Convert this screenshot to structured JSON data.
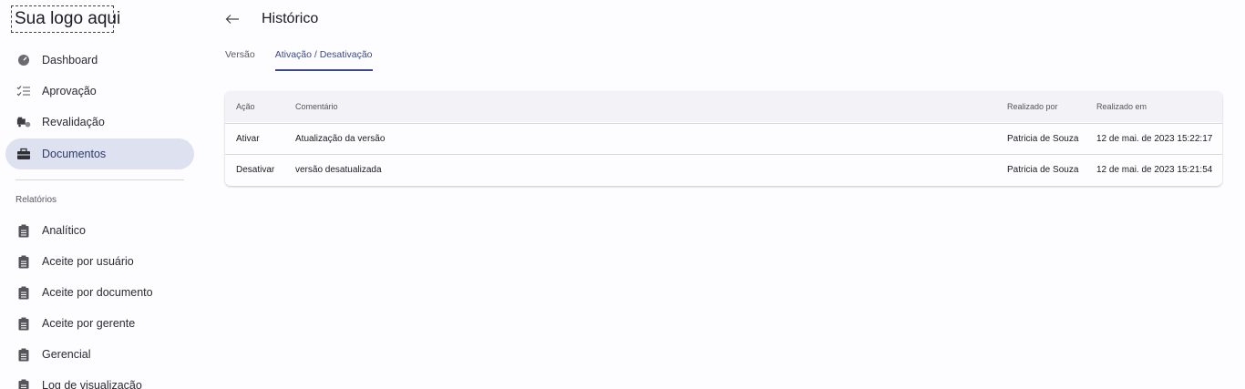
{
  "logo": {
    "text": "Sua logo aqui"
  },
  "sidebar": {
    "items": [
      {
        "label": "Dashboard",
        "icon": "dashboard-gauge-icon"
      },
      {
        "label": "Aprovação",
        "icon": "checklist-icon"
      },
      {
        "label": "Revalidação",
        "icon": "truck-clock-icon"
      },
      {
        "label": "Documentos",
        "icon": "briefcase-icon",
        "active": true
      }
    ],
    "section_label": "Relatórios",
    "reports": [
      {
        "label": "Analítico",
        "icon": "clipboard-icon"
      },
      {
        "label": "Aceite por usuário",
        "icon": "clipboard-icon"
      },
      {
        "label": "Aceite por documento",
        "icon": "clipboard-icon"
      },
      {
        "label": "Aceite por gerente",
        "icon": "clipboard-icon"
      },
      {
        "label": "Gerencial",
        "icon": "clipboard-icon"
      },
      {
        "label": "Log de visualização",
        "icon": "clipboard-icon"
      }
    ]
  },
  "header": {
    "title": "Histórico",
    "back_icon": "arrow-left-icon"
  },
  "tabs": [
    {
      "label": "Versão",
      "active": false
    },
    {
      "label": "Ativação / Desativação",
      "active": true
    }
  ],
  "table": {
    "columns": [
      "Ação",
      "Comentário",
      "Realizado por",
      "Realizado em"
    ],
    "rows": [
      [
        "Ativar",
        "Atualização da versão",
        "Patricia de Souza",
        "12 de mai. de 2023 15:22:17"
      ],
      [
        "Desativar",
        "versão desatualizada",
        "Patricia de Souza",
        "12 de mai. de 2023 15:21:54"
      ]
    ]
  },
  "colors": {
    "accent": "#3b4a8a",
    "active_bg": "#dde1f0"
  }
}
